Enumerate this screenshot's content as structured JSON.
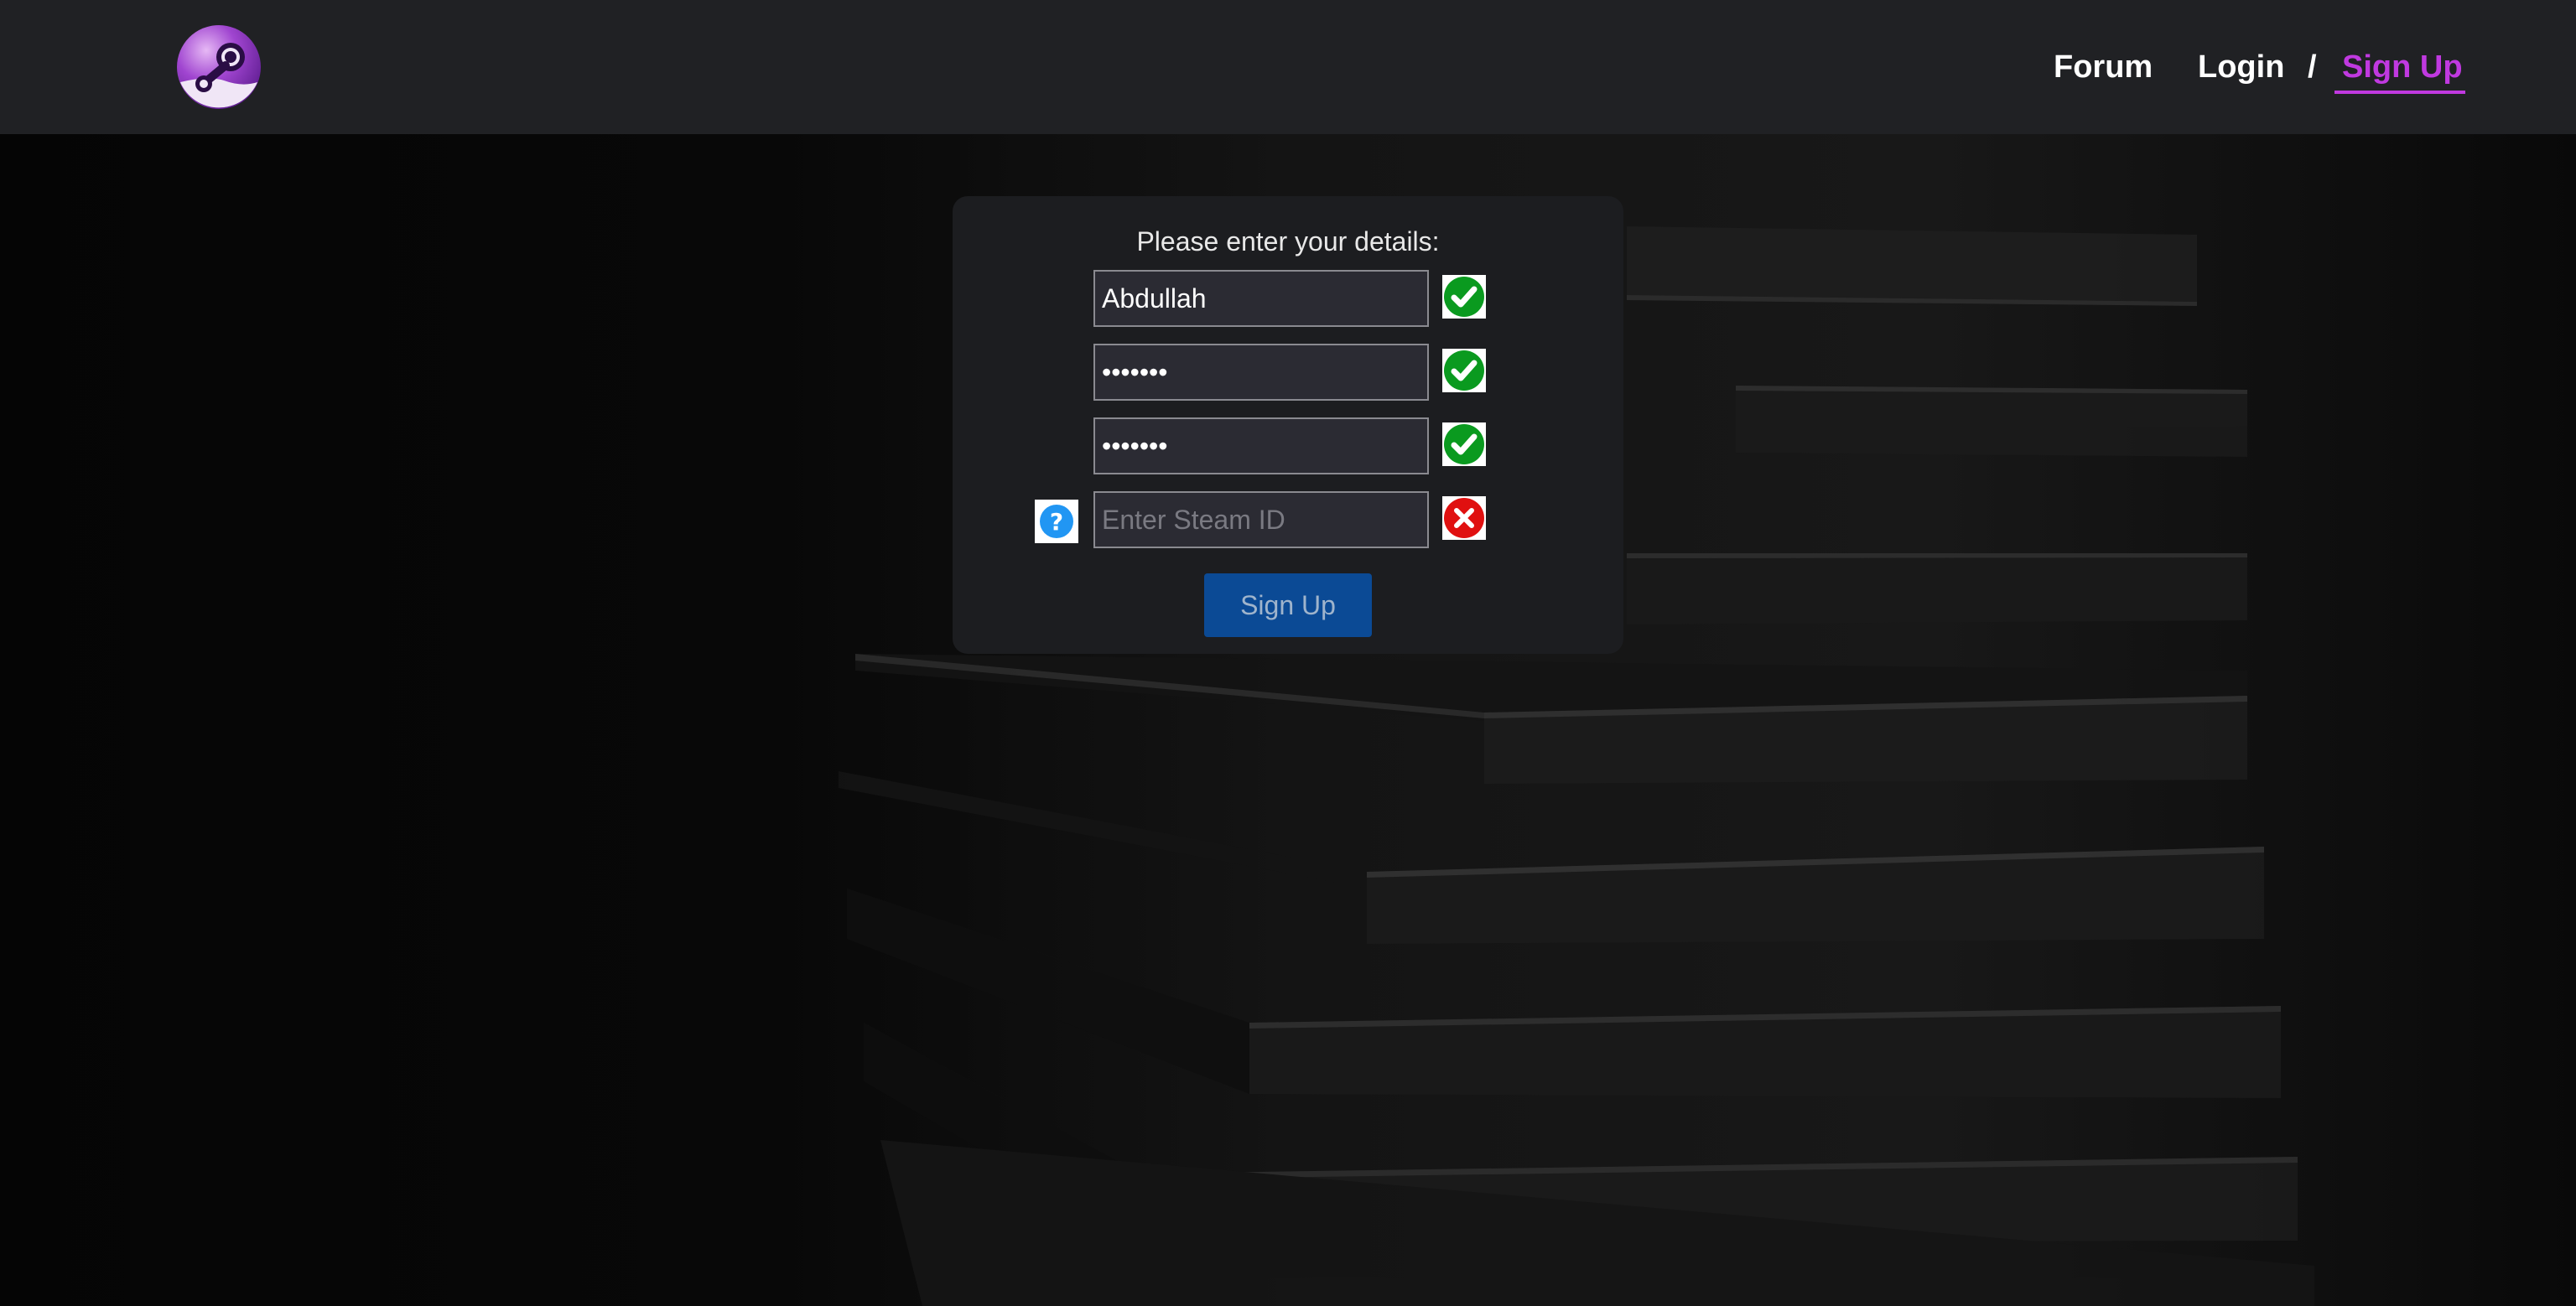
{
  "header": {
    "logo_icon": "steam-logo-icon",
    "nav": {
      "forum": "Forum",
      "login": "Login",
      "separator": "/",
      "signup": "Sign Up"
    }
  },
  "form": {
    "title": "Please enter your details:",
    "username_value": "Abdullah",
    "password_value": "•••••••",
    "confirm_password_value": "•••••••",
    "steam_id_value": "",
    "steam_id_placeholder": "Enter Steam ID",
    "help_icon": "question-icon",
    "status": [
      "valid",
      "valid",
      "valid",
      "invalid"
    ],
    "submit_label": "Sign Up"
  },
  "colors": {
    "accent": "#c039e0",
    "header_bg": "#202124",
    "card_bg": "#1c1d20",
    "button_bg": "#0b4a95",
    "valid": "#0a9a1f",
    "invalid": "#e01010",
    "help": "#2196f3"
  }
}
